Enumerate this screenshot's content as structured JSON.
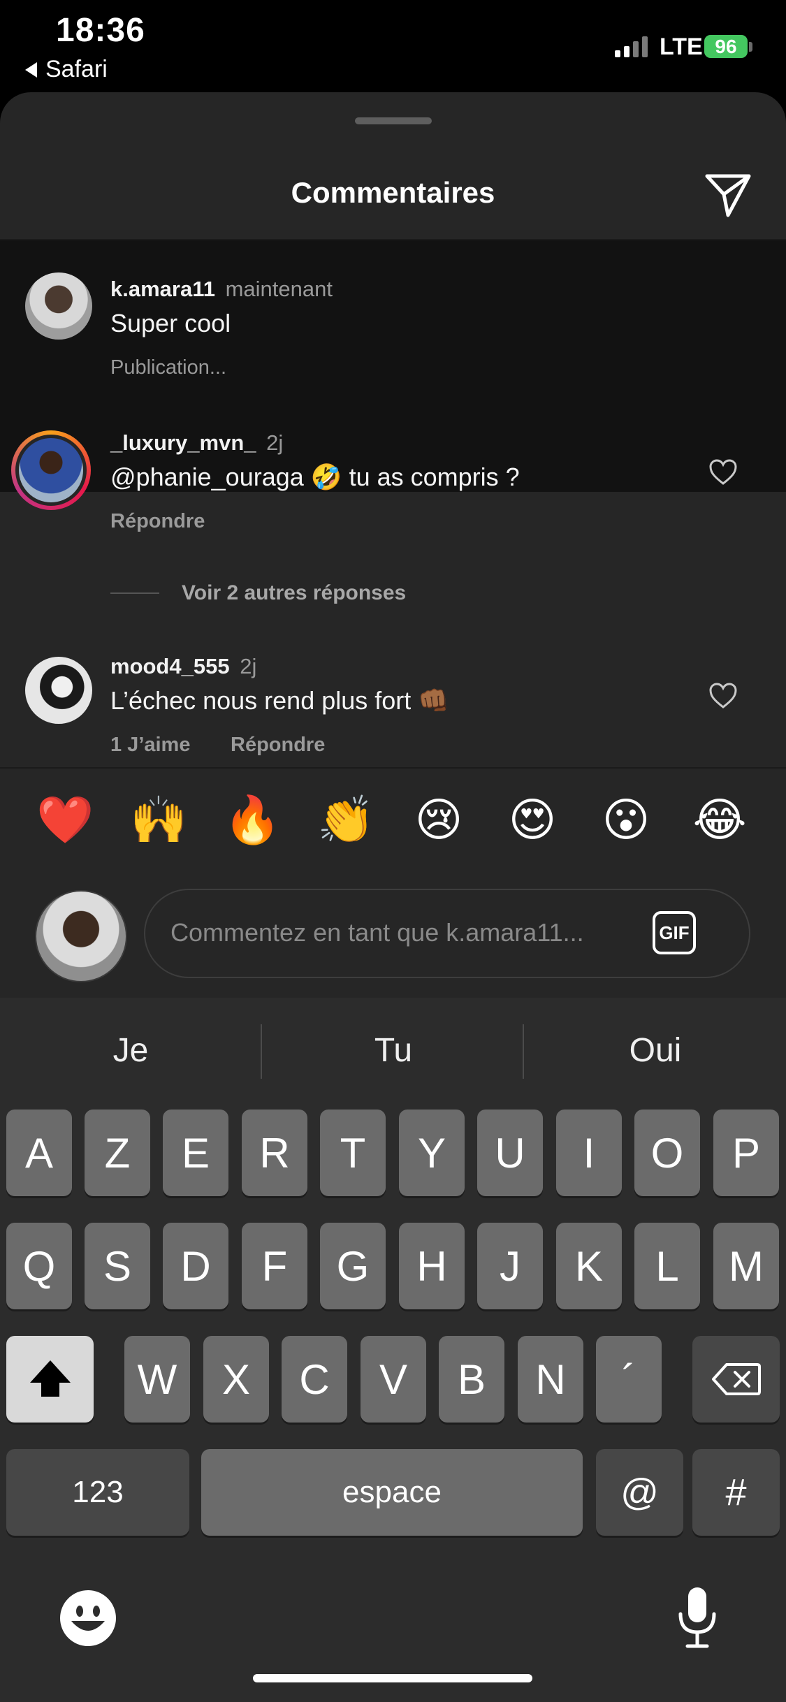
{
  "status_bar": {
    "time": "18:36",
    "back_app": "Safari",
    "network": "LTE",
    "battery": "96"
  },
  "sheet": {
    "title": "Commentaires"
  },
  "comments": [
    {
      "username": "k.amara11",
      "time": "maintenant",
      "text": "Super cool",
      "meta": "Publication..."
    },
    {
      "username": "_luxury_mvn_",
      "time": "2j",
      "text": "@phanie_ouraga 🤣 tu as compris ?",
      "reply": "Répondre"
    },
    {
      "username": "mood4_555",
      "time": "2j",
      "text": "L’échec nous rend plus fort 👊🏾",
      "likes": "1 J’aime",
      "reply": "Répondre"
    }
  ],
  "view_replies": "Voir 2 autres réponses",
  "quick_emojis": [
    "❤️",
    "🙌",
    "🔥",
    "👏",
    "😢",
    "😍",
    "😮",
    "😂"
  ],
  "comment_input": {
    "placeholder": "Commentez en tant que k.amara11...",
    "gif_label": "GIF"
  },
  "keyboard": {
    "suggestions": [
      "Je",
      "Tu",
      "Oui"
    ],
    "row1": [
      "A",
      "Z",
      "E",
      "R",
      "T",
      "Y",
      "U",
      "I",
      "O",
      "P"
    ],
    "row2": [
      "Q",
      "S",
      "D",
      "F",
      "G",
      "H",
      "J",
      "K",
      "L",
      "M"
    ],
    "row3": [
      "W",
      "X",
      "C",
      "V",
      "B",
      "N",
      "´"
    ],
    "numbers_key": "123",
    "space_key": "espace",
    "at_key": "@",
    "hash_key": "#"
  }
}
